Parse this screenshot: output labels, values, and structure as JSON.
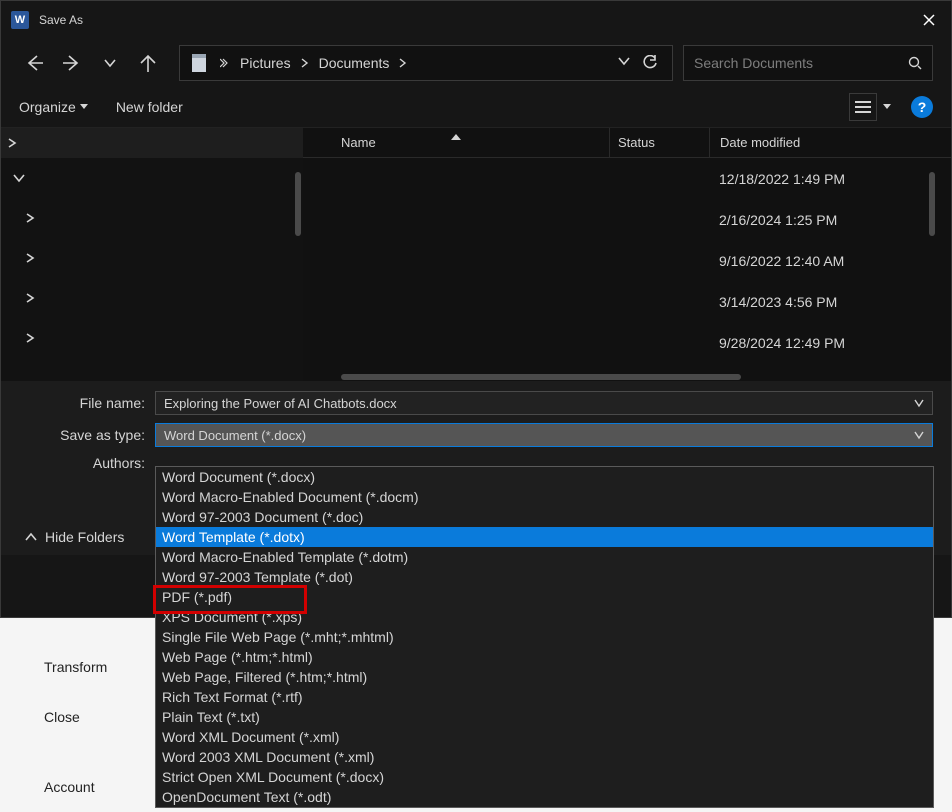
{
  "titlebar": {
    "app_badge": "W",
    "title": "Save As"
  },
  "nav": {
    "breadcrumb": [
      "Pictures",
      "Documents"
    ],
    "search_placeholder": "Search Documents"
  },
  "toolbar": {
    "organize": "Organize",
    "new_folder": "New folder"
  },
  "columns": {
    "name": "Name",
    "status": "Status",
    "date": "Date modified"
  },
  "files": [
    {
      "name": "",
      "status": "",
      "date": "12/18/2022 1:49 PM"
    },
    {
      "name": "",
      "status": "",
      "date": "2/16/2024 1:25 PM"
    },
    {
      "name": "",
      "status": "",
      "date": "9/16/2022 12:40 AM"
    },
    {
      "name": "",
      "status": "",
      "date": "3/14/2023 4:56 PM"
    },
    {
      "name": "",
      "status": "",
      "date": "9/28/2024 12:49 PM"
    }
  ],
  "form": {
    "file_name_label": "File name:",
    "file_name_value": "Exploring the Power of AI Chatbots.docx",
    "save_type_label": "Save as type:",
    "save_type_value": "Word Document (*.docx)",
    "authors_label": "Authors:"
  },
  "dropdown_options": [
    {
      "label": "Word Document (*.docx)",
      "hl": false
    },
    {
      "label": "Word Macro-Enabled Document (*.docm)",
      "hl": false
    },
    {
      "label": "Word 97-2003 Document (*.doc)",
      "hl": false
    },
    {
      "label": "Word Template (*.dotx)",
      "hl": true
    },
    {
      "label": "Word Macro-Enabled Template (*.dotm)",
      "hl": false
    },
    {
      "label": "Word 97-2003 Template (*.dot)",
      "hl": false
    },
    {
      "label": "PDF (*.pdf)",
      "hl": false,
      "marked": true
    },
    {
      "label": "XPS Document (*.xps)",
      "hl": false
    },
    {
      "label": "Single File Web Page (*.mht;*.mhtml)",
      "hl": false
    },
    {
      "label": "Web Page (*.htm;*.html)",
      "hl": false
    },
    {
      "label": "Web Page, Filtered (*.htm;*.html)",
      "hl": false
    },
    {
      "label": "Rich Text Format (*.rtf)",
      "hl": false
    },
    {
      "label": "Plain Text (*.txt)",
      "hl": false
    },
    {
      "label": "Word XML Document (*.xml)",
      "hl": false
    },
    {
      "label": "Word 2003 XML Document (*.xml)",
      "hl": false
    },
    {
      "label": "Strict Open XML Document (*.docx)",
      "hl": false
    },
    {
      "label": "OpenDocument Text (*.odt)",
      "hl": false
    }
  ],
  "hide_folders": "Hide Folders",
  "backstage": {
    "transform": "Transform",
    "close": "Close",
    "account": "Account"
  }
}
